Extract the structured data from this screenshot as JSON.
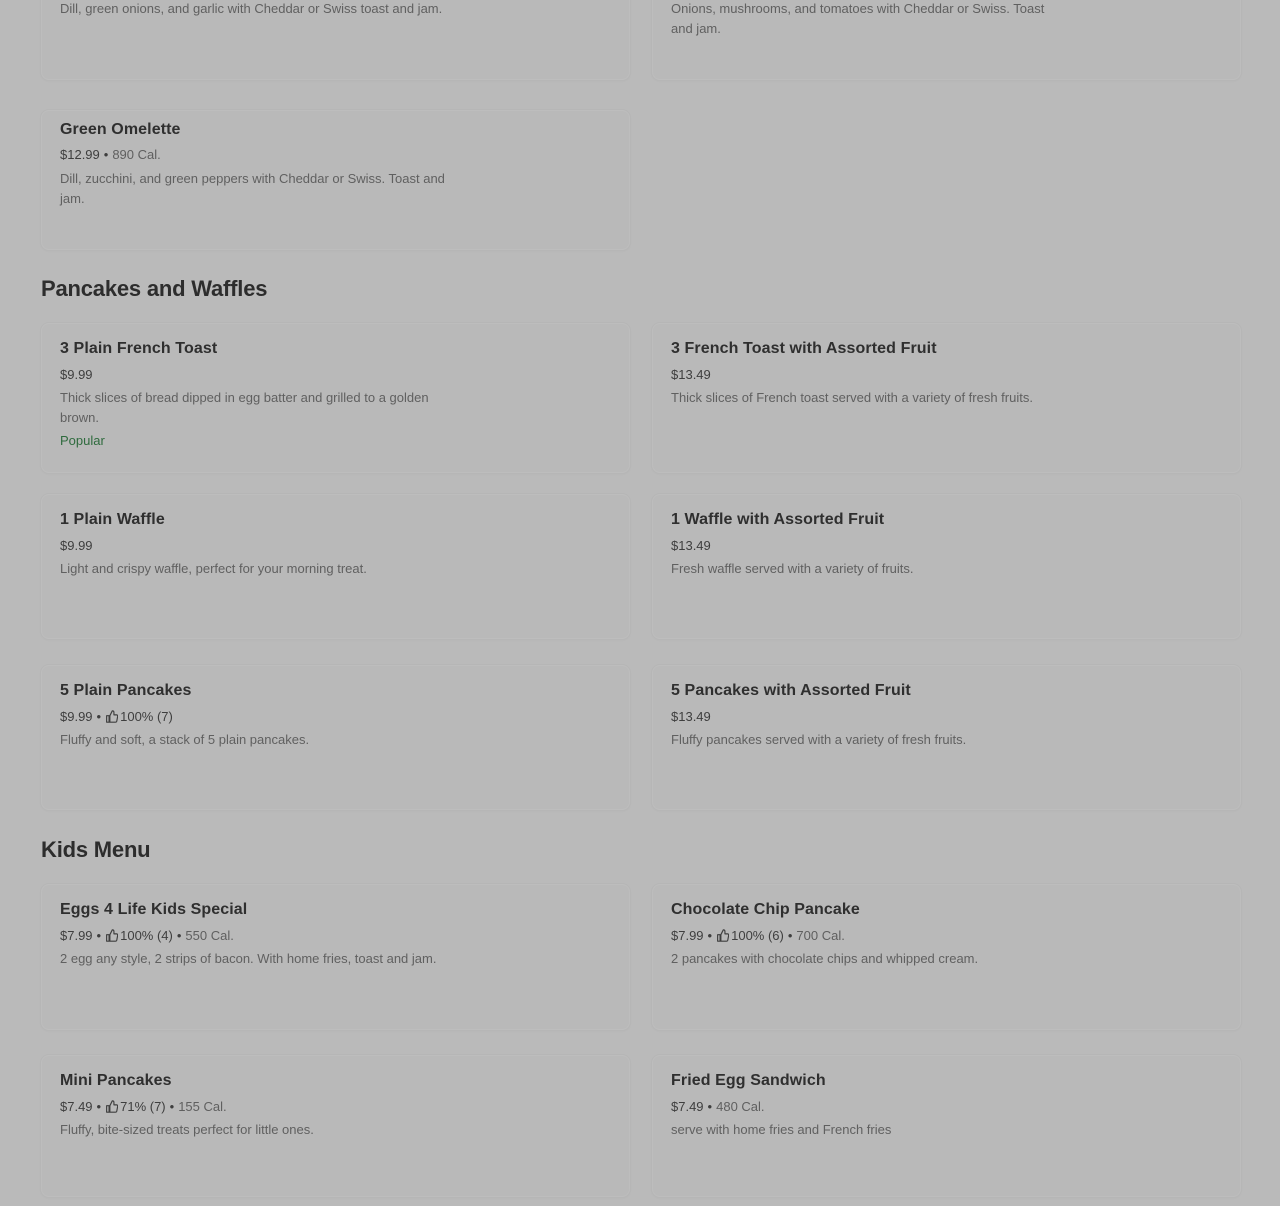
{
  "top_items": [
    {
      "description": "Dill, green onions, and garlic with Cheddar or Swiss toast and jam."
    },
    {
      "description": "Onions, mushrooms, and tomatoes with Cheddar or Swiss. Toast and jam."
    }
  ],
  "green_omelette": {
    "name": "Green Omelette",
    "price": "$12.99",
    "calories": "890 Cal.",
    "description": "Dill, zucchini, and green peppers with Cheddar or Swiss. Toast and jam."
  },
  "pancakes_section": {
    "title": "Pancakes and Waffles",
    "items": [
      {
        "name": "3 Plain French Toast",
        "price": "$9.99",
        "description": "Thick slices of bread dipped in egg batter and grilled to a golden brown.",
        "badge": "Popular"
      },
      {
        "name": "3 French Toast with Assorted Fruit",
        "price": "$13.49",
        "description": "Thick slices of French toast served with a variety of fresh fruits."
      },
      {
        "name": "1 Plain Waffle",
        "price": "$9.99",
        "description": "Light and crispy waffle, perfect for your morning treat."
      },
      {
        "name": "1 Waffle with Assorted Fruit",
        "price": "$13.49",
        "description": "Fresh waffle served with a variety of fruits."
      },
      {
        "name": "5 Plain Pancakes",
        "price": "$9.99",
        "rating": "100% (7)",
        "description": "Fluffy and soft, a stack of 5 plain pancakes."
      },
      {
        "name": "5 Pancakes with Assorted Fruit",
        "price": "$13.49",
        "description": "Fluffy pancakes served with a variety of fresh fruits."
      }
    ]
  },
  "kids_section": {
    "title": "Kids Menu",
    "items": [
      {
        "name": "Eggs 4 Life Kids Special",
        "price": "$7.99",
        "rating": "100% (4)",
        "calories": "550 Cal.",
        "description": "2 egg any style, 2 strips of bacon. With home fries, toast and jam."
      },
      {
        "name": "Chocolate Chip Pancake",
        "price": "$7.99",
        "rating": "100% (6)",
        "calories": "700 Cal.",
        "description": "2 pancakes with chocolate chips and whipped cream."
      },
      {
        "name": "Mini Pancakes",
        "price": "$7.49",
        "rating": "71% (7)",
        "calories": "155 Cal.",
        "description": "Fluffy, bite-sized treats perfect for little ones."
      },
      {
        "name": "Fried Egg Sandwich",
        "price": "$7.49",
        "calories": "480 Cal.",
        "description": "serve with home fries and French fries"
      }
    ]
  },
  "separator": "•",
  "colors": {
    "background": "#bababa",
    "card": "#b9b9b9",
    "popular": "#2f6b3e"
  },
  "icons": {
    "rating": "thumbs-up-icon"
  }
}
